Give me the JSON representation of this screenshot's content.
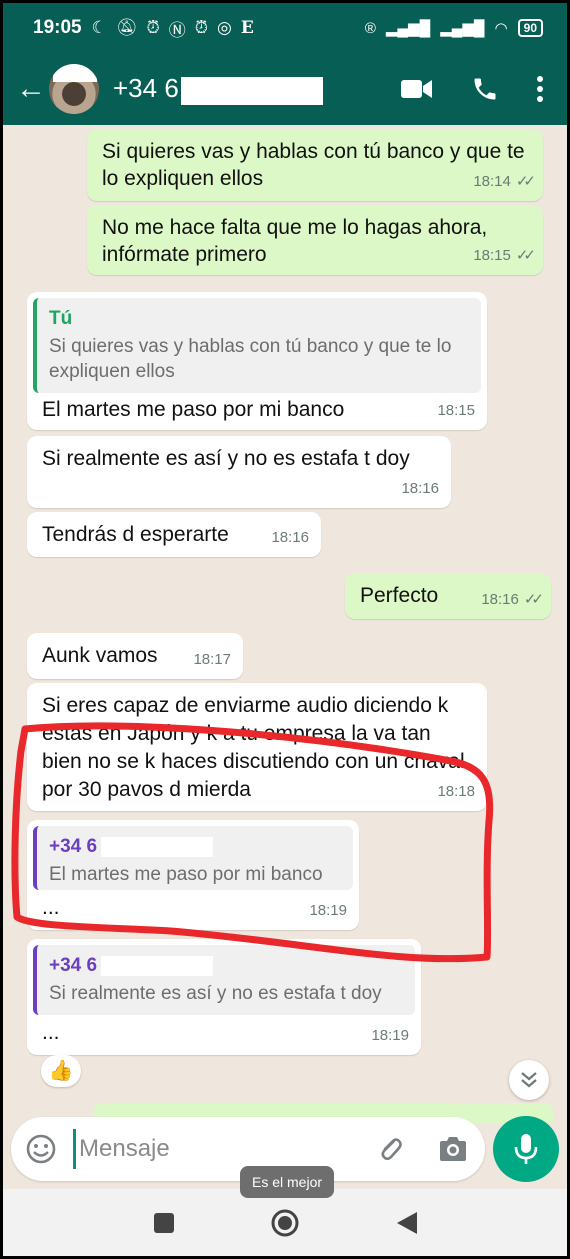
{
  "status_bar": {
    "time": "19:05",
    "icons": [
      "moon-icon",
      "bell-off-icon",
      "alarm-icon",
      "nfc-icon",
      "alarm-icon",
      "instagram-icon",
      "e-icon"
    ],
    "battery": "90"
  },
  "header": {
    "contact_name": "+34 6",
    "colors": {
      "header_bg": "#075e54"
    }
  },
  "messages": [
    {
      "id": "m1",
      "direction": "out",
      "text": "Si quieres vas y hablas con tú banco y que te lo expliquen ellos",
      "time": "18:14",
      "ticks": "✓✓"
    },
    {
      "id": "m2",
      "direction": "out",
      "text": "No me hace falta que me lo hagas ahora, infórmate primero",
      "time": "18:15",
      "ticks": "✓✓"
    },
    {
      "id": "m3",
      "direction": "in",
      "quote_name": "Tú",
      "quote_text": "Si quieres vas y hablas con tú banco y que te lo expliquen ellos",
      "text": "El martes me paso por mi banco",
      "time": "18:15"
    },
    {
      "id": "m4",
      "direction": "in",
      "text": "Si realmente es así y no es estafa t doy",
      "time": "18:16"
    },
    {
      "id": "m5",
      "direction": "in",
      "text": "Tendrás d esperarte",
      "time": "18:16"
    },
    {
      "id": "m6",
      "direction": "out",
      "text": "Perfecto",
      "time": "18:16",
      "ticks": "✓✓"
    },
    {
      "id": "m7",
      "direction": "in",
      "text": "Aunk vamos",
      "time": "18:17"
    },
    {
      "id": "m8",
      "direction": "in",
      "text": "Si eres capaz de enviarme audio diciendo k estás en Japón y k a tu empresa la va tan bien no se k haces discutiendo con un chaval por 30 pavos d mierda",
      "time": "18:18"
    },
    {
      "id": "m9",
      "direction": "in",
      "quote_name": "+34 6",
      "quote_text": "El martes me paso por mi banco",
      "text": "...",
      "time": "18:19"
    },
    {
      "id": "m10",
      "direction": "in",
      "quote_name": "+34 6",
      "quote_text": "Si realmente es así y no es estafa t doy",
      "text": "...",
      "time": "18:19",
      "reaction": "👍"
    }
  ],
  "input": {
    "placeholder": "Mensaje"
  },
  "tooltip": "Es el mejor",
  "colors": {
    "accent": "#00a884",
    "outgoing_bubble": "#dcf8c6",
    "incoming_bubble": "#ffffff",
    "highlight": "#e8282b"
  }
}
